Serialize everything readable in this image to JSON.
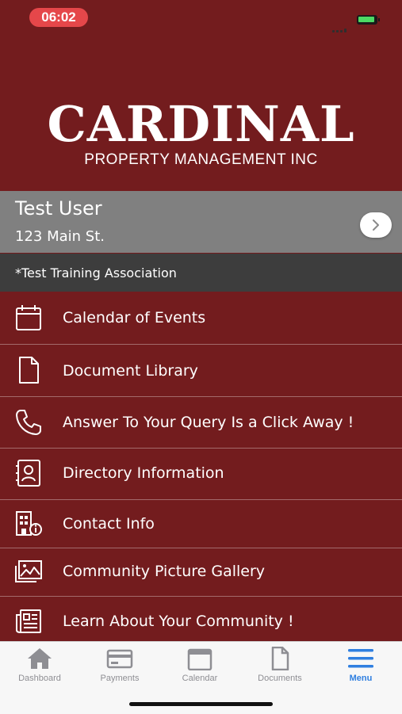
{
  "status_bar": {
    "time": "06:02"
  },
  "logo": {
    "main": "CARDINAL",
    "sub": "PROPERTY MANAGEMENT INC"
  },
  "user": {
    "name": "Test User",
    "address": "123 Main St.",
    "association": "*Test Training Association"
  },
  "menu": {
    "items": [
      {
        "label": "Calendar of Events",
        "icon": "calendar-icon"
      },
      {
        "label": "Document Library",
        "icon": "document-icon"
      },
      {
        "label": "Answer To Your Query Is a Click Away !",
        "icon": "phone-icon"
      },
      {
        "label": "Directory Information",
        "icon": "contact-card-icon"
      },
      {
        "label": "Contact Info",
        "icon": "building-info-icon"
      },
      {
        "label": "Community Picture Gallery",
        "icon": "gallery-icon"
      },
      {
        "label": "Learn About Your Community !",
        "icon": "newspaper-icon"
      }
    ]
  },
  "tabbar": {
    "tabs": [
      {
        "label": "Dashboard",
        "icon": "home-icon"
      },
      {
        "label": "Payments",
        "icon": "credit-card-icon"
      },
      {
        "label": "Calendar",
        "icon": "calendar-icon"
      },
      {
        "label": "Documents",
        "icon": "document-icon"
      },
      {
        "label": "Menu",
        "icon": "hamburger-menu-icon",
        "active": true
      }
    ]
  },
  "colors": {
    "background": "#731c1e",
    "user_card": "#808080",
    "association_bar": "#3d3d3d",
    "tab_active": "#2f7fe0",
    "tab_inactive": "#8e8e93",
    "time_pill": "#e5474a"
  }
}
